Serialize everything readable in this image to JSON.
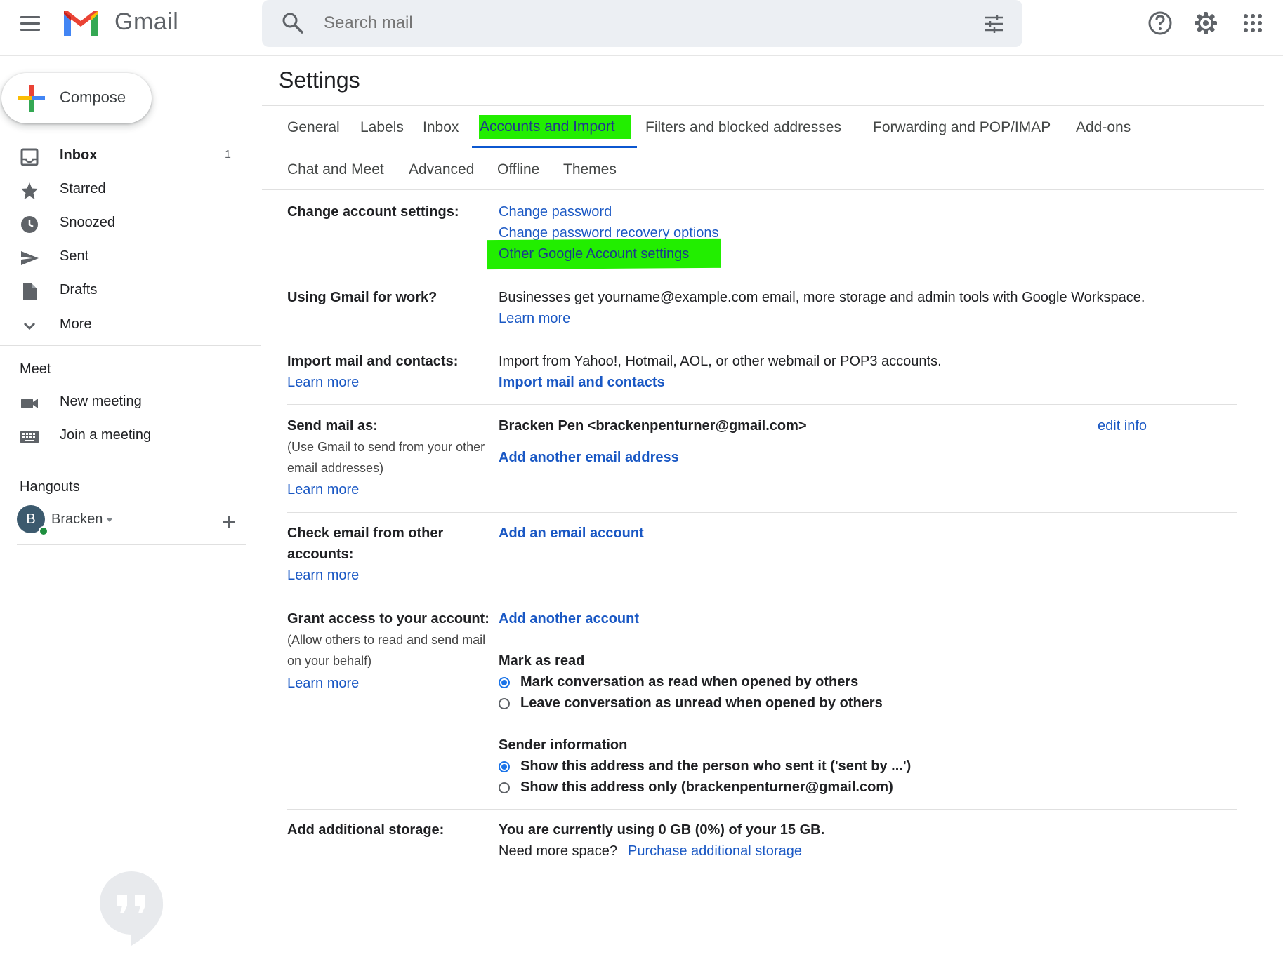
{
  "header": {
    "app_name": "Gmail",
    "search_placeholder": "Search mail"
  },
  "sidebar": {
    "compose_label": "Compose",
    "items": [
      {
        "label": "Inbox",
        "count": "1"
      },
      {
        "label": "Starred"
      },
      {
        "label": "Snoozed"
      },
      {
        "label": "Sent"
      },
      {
        "label": "Drafts"
      },
      {
        "label": "More"
      }
    ],
    "meet_title": "Meet",
    "meet_items": [
      {
        "label": "New meeting"
      },
      {
        "label": "Join a meeting"
      }
    ],
    "hangouts_title": "Hangouts",
    "hangouts_user": "Bracken",
    "hangouts_avatar_letter": "B"
  },
  "settings": {
    "title": "Settings",
    "tabs": [
      "General",
      "Labels",
      "Inbox",
      "Accounts and Import",
      "Filters and blocked addresses",
      "Forwarding and POP/IMAP",
      "Add-ons",
      "Chat and Meet",
      "Advanced",
      "Offline",
      "Themes"
    ],
    "active_tab": "Accounts and Import",
    "highlight_color": "#22ee00",
    "rows": {
      "change_account": {
        "label": "Change account settings:",
        "links": [
          "Change password",
          "Change password recovery options",
          "Other Google Account settings"
        ]
      },
      "work": {
        "label": "Using Gmail for work?",
        "text": "Businesses get yourname@example.com email, more storage and admin tools with Google Workspace.",
        "link": "Learn more"
      },
      "import": {
        "label": "Import mail and contacts:",
        "label_link": "Learn more",
        "text": "Import from Yahoo!, Hotmail, AOL, or other webmail or POP3 accounts.",
        "action": "Import mail and contacts"
      },
      "send_as": {
        "label": "Send mail as:",
        "note_line1": "(Use Gmail to send from your other",
        "note_line2": "email addresses)",
        "label_link": "Learn more",
        "address": "Bracken Pen <brackenpenturner@gmail.com>",
        "edit": "edit info",
        "action": "Add another email address"
      },
      "check_email": {
        "label_line1": "Check email from other",
        "label_line2": "accounts:",
        "label_link": "Learn more",
        "action": "Add an email account"
      },
      "grant": {
        "label": "Grant access to your account:",
        "note_line1": "(Allow others to read and send mail",
        "note_line2": "on your behalf)",
        "label_link": "Learn more",
        "action": "Add another account",
        "mark_title": "Mark as read",
        "mark_options": [
          "Mark conversation as read when opened by others",
          "Leave conversation as unread when opened by others"
        ],
        "mark_selected": 0,
        "sender_title": "Sender information",
        "sender_options": [
          "Show this address and the person who sent it ('sent by ...')",
          "Show this address only (brackenpenturner@gmail.com)"
        ],
        "sender_selected": 0
      },
      "storage": {
        "label": "Add additional storage:",
        "usage": "You are currently using 0 GB (0%) of your 15 GB.",
        "prompt": "Need more space?",
        "link": "Purchase additional storage"
      }
    }
  }
}
